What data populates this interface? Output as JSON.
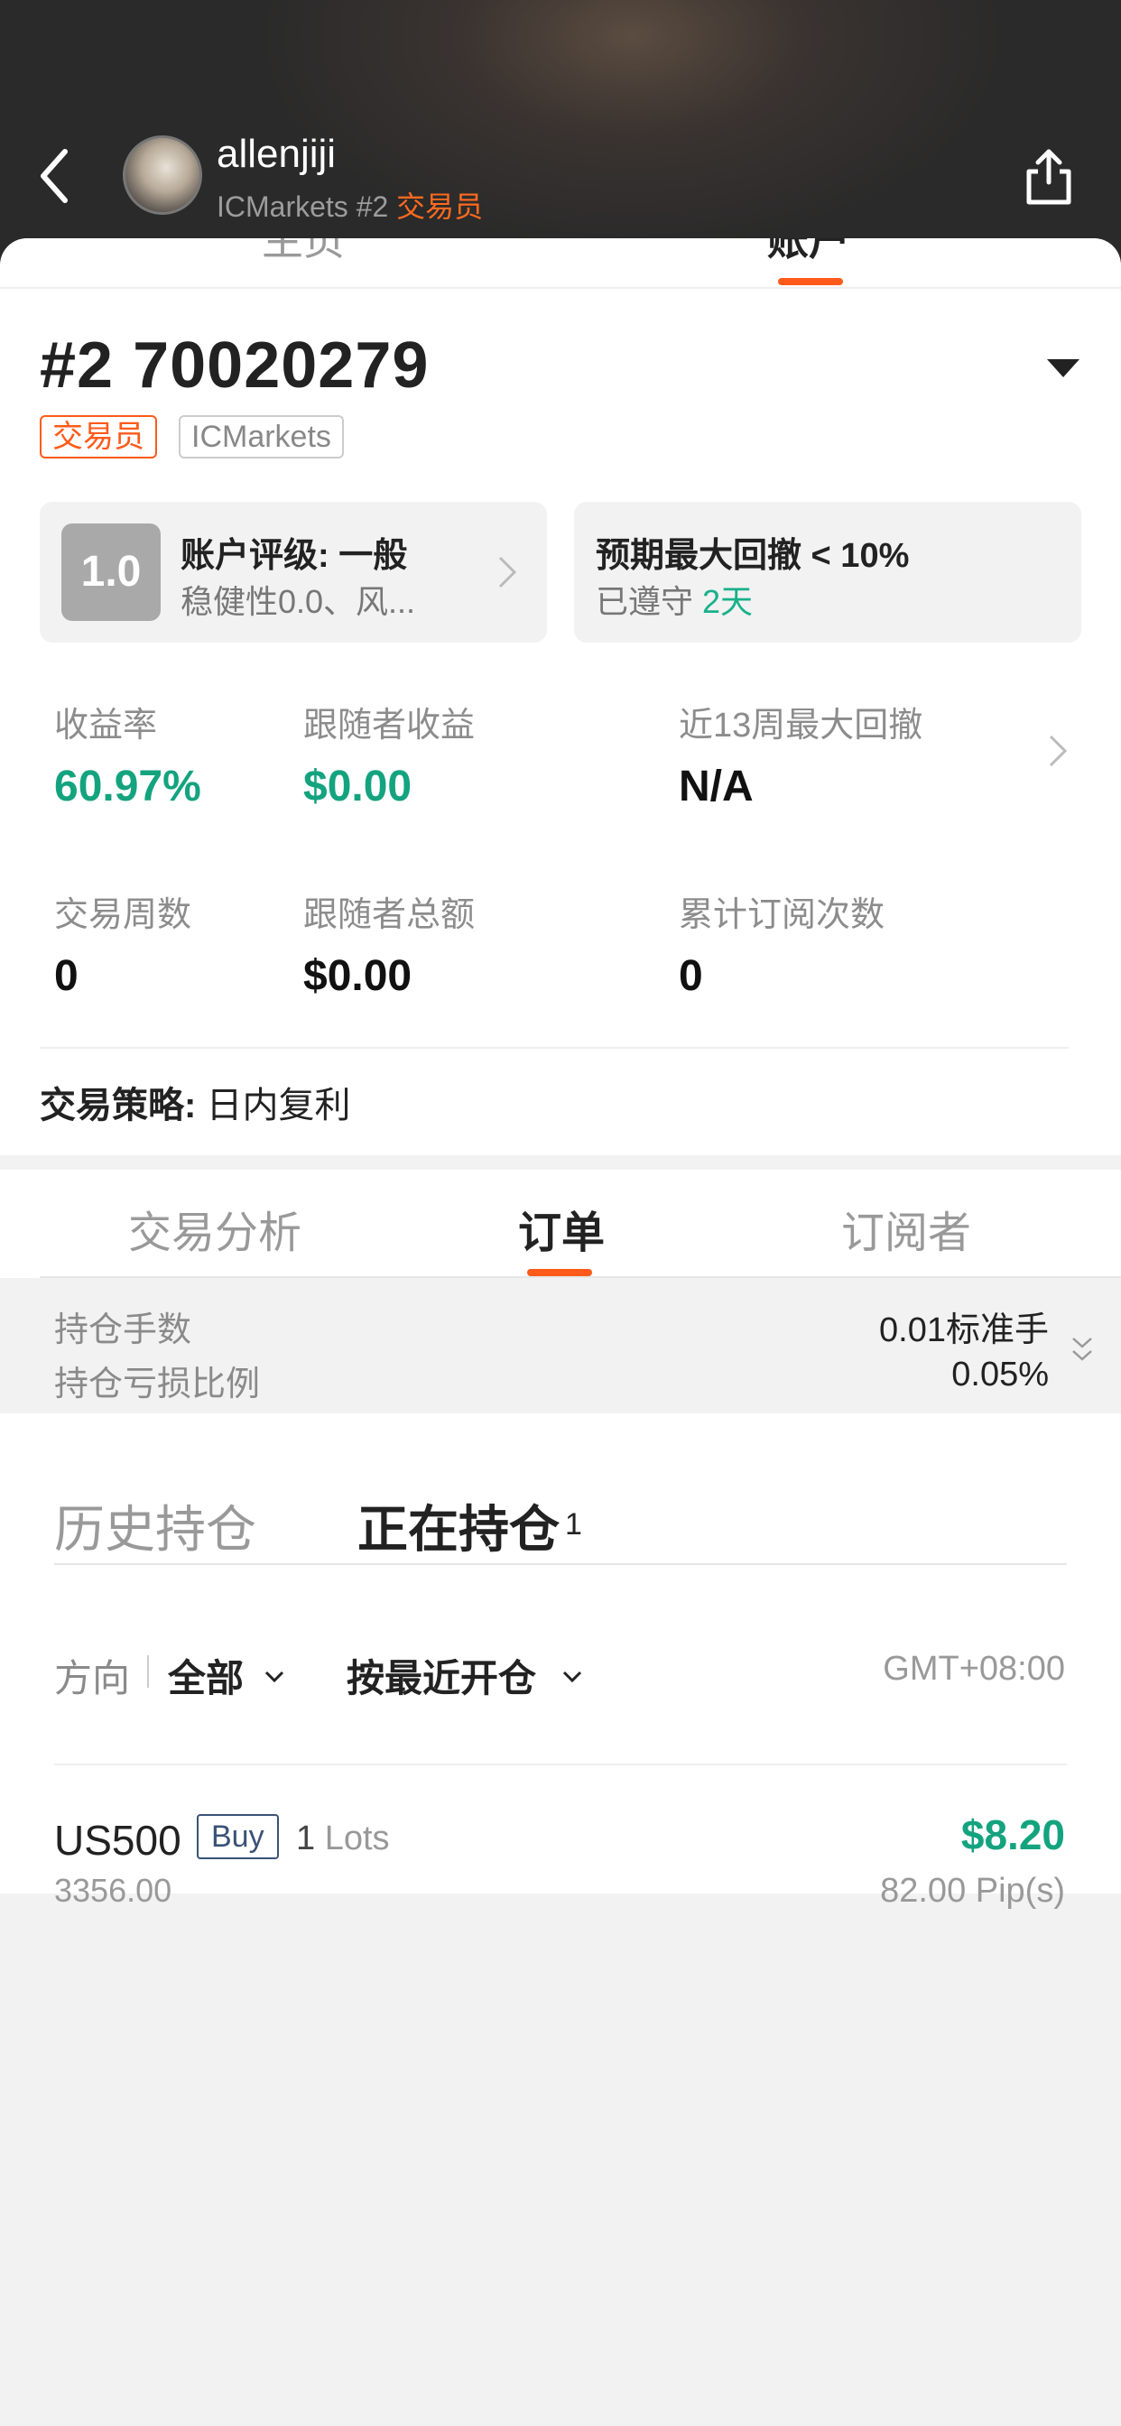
{
  "header": {
    "username": "allenjiji",
    "broker_rank": "ICMarkets #2",
    "role": "交易员"
  },
  "top_tabs": {
    "hidden_left": "主页",
    "hidden_right": "账户"
  },
  "account": {
    "title": "#2 70020279",
    "tag_role": "交易员",
    "tag_broker": "ICMarkets",
    "rating_score": "1.0",
    "rating_title": "账户评级: 一般",
    "rating_sub": "稳健性0.0、风...",
    "drawdown_title": "预期最大回撤 < 10%",
    "drawdown_sub_prefix": "已遵守 ",
    "drawdown_sub_days": "2天"
  },
  "stats": {
    "return_label": "收益率",
    "return_value": "60.97%",
    "follower_profit_label": "跟随者收益",
    "follower_profit_value": "$0.00",
    "max_dd_label": "近13周最大回撤",
    "max_dd_value": "N/A",
    "weeks_label": "交易周数",
    "weeks_value": "0",
    "follower_total_label": "跟随者总额",
    "follower_total_value": "$0.00",
    "subs_label": "累计订阅次数",
    "subs_value": "0"
  },
  "strategy": {
    "label": "交易策略:",
    "value": " 日内复利"
  },
  "content_tabs": [
    "交易分析",
    "订单",
    "订阅者"
  ],
  "position_summary": {
    "lots_label": "持仓手数",
    "lots_value": "0.01标准手",
    "ratio_label": "持仓亏损比例",
    "ratio_value": "0.05%"
  },
  "order_tabs": {
    "history": "历史持仓",
    "open": "正在持仓",
    "open_count": "1"
  },
  "filters": {
    "direction_label": "方向",
    "direction_value": "全部",
    "sort_value": "按最近开仓",
    "timezone": "GMT+08:00"
  },
  "order": {
    "symbol": "US500",
    "side": "Buy",
    "lots_count": "1",
    "lots_unit": " Lots",
    "open_price": "3356.00",
    "profit": "$8.20",
    "pips": "82.00 Pip(s)"
  },
  "colors": {
    "accent": "#ff5a1a",
    "positive": "#14a37f",
    "buy_border": "#3b5277"
  }
}
